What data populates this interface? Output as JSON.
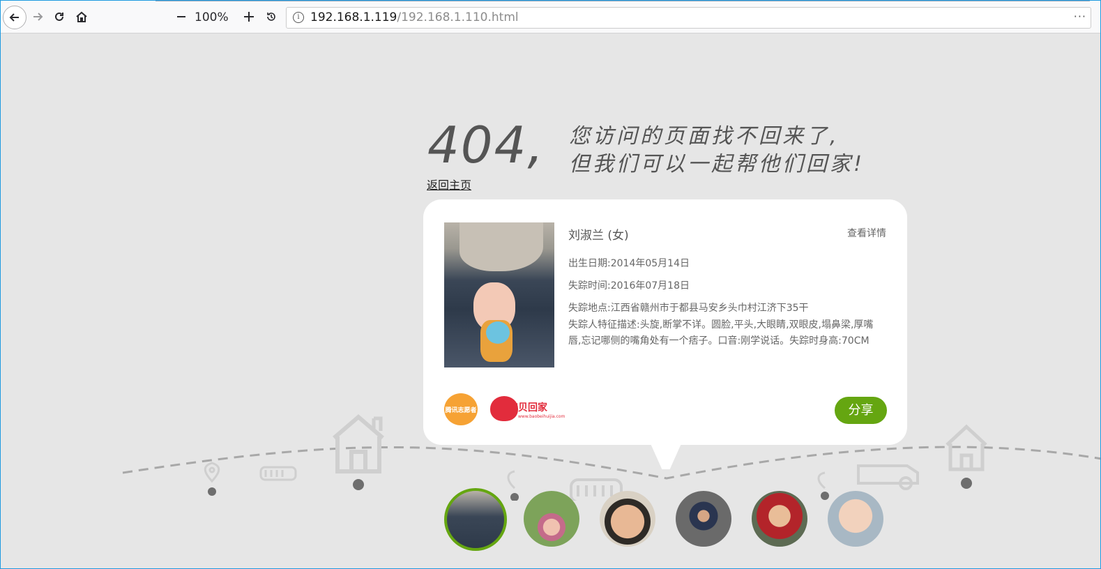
{
  "browser": {
    "zoom_level": "100%",
    "url_host": "192.168.1.119",
    "url_path": "/192.168.1.110.html",
    "page_actions_menu": "···"
  },
  "page": {
    "error_code": "404,",
    "message_line1": "您访问的页面找不回来了,",
    "message_line2": "但我们可以一起帮他们回家!",
    "home_link": "返回主页"
  },
  "card": {
    "name": "刘淑兰 (女)",
    "detail_link": "查看详情",
    "birth_date": "出生日期:2014年05月14日",
    "missing_time": "失踪时间:2016年07月18日",
    "missing_place": "失踪地点:江西省赣州市于都县马安乡头巾村江济下35干",
    "description": "失踪人特征描述:头旋,断掌不详。圆脸,平头,大眼睛,双眼皮,塌鼻梁,厚嘴唇,忘记哪侧的嘴角处有一个痞子。口音:刚学说话。失踪时身高:70CM",
    "logo1_text": "腾讯志愿者",
    "logo2_text": "宝贝回家",
    "logo2_sub": "www.baobeihuijia.com",
    "share_label": "分享"
  },
  "colors": {
    "accent_green": "#65a611",
    "background": "#e6e6e6"
  }
}
